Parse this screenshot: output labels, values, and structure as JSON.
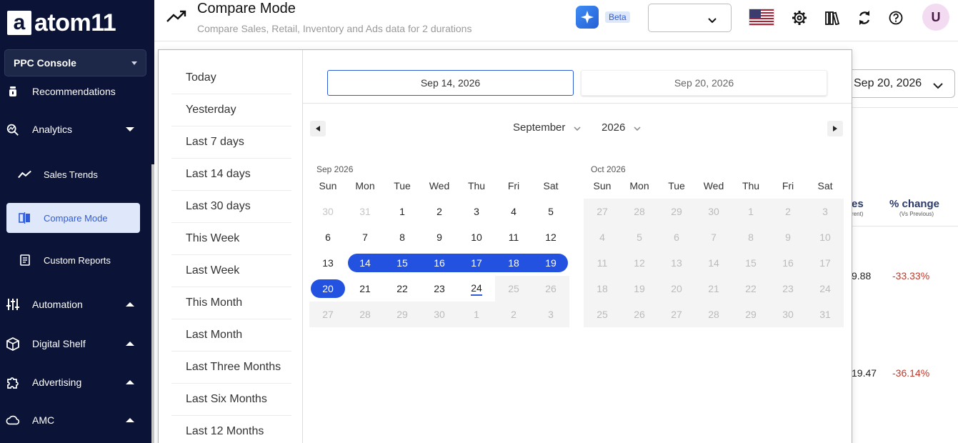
{
  "brand": {
    "logo_letter": "a",
    "name": "atom11"
  },
  "console_select": {
    "value": "PPC Console"
  },
  "sidebar": {
    "items": [
      {
        "label": "Recommendations",
        "icon": "bulb-icon"
      },
      {
        "label": "Analytics",
        "icon": "analytics-icon"
      },
      {
        "label": "Automation",
        "icon": "sliders-icon"
      },
      {
        "label": "Digital Shelf",
        "icon": "box-icon"
      },
      {
        "label": "Advertising",
        "icon": "puzzle-icon"
      },
      {
        "label": "AMC",
        "icon": "cloud-icon"
      }
    ],
    "subitems": [
      {
        "label": "Sales Trends",
        "icon": "trend-icon"
      },
      {
        "label": "Compare Mode",
        "icon": "compare-icon",
        "active": true
      },
      {
        "label": "Custom Reports",
        "icon": "report-icon"
      }
    ]
  },
  "header": {
    "title": "Compare Mode",
    "subtitle": "Compare Sales, Retail, Inventory and Ads data for 2 durations",
    "beta": "Beta",
    "select_value": "",
    "avatar": "U"
  },
  "background": {
    "date_value": "Sep 20, 2026",
    "col1_title": "es",
    "col1_sub": "rent)",
    "col2_title": "% change",
    "col2_sub": "(Vs Previous)",
    "row1_value": "9.88",
    "row1_change": "-33.33%",
    "row2_value": "19.47",
    "row2_change": "-36.14%",
    "negative_color": "#c0392b"
  },
  "picker": {
    "presets": [
      "Today",
      "Yesterday",
      "Last 7 days",
      "Last 14 days",
      "Last 30 days",
      "This Week",
      "Last Week",
      "This Month",
      "Last Month",
      "Last Three Months",
      "Last Six Months",
      "Last 12 Months"
    ],
    "start_date": "Sep 14, 2026",
    "end_date": "Sep 20, 2026",
    "month_select": "September",
    "year_select": "2026",
    "weekdays": [
      "Sun",
      "Mon",
      "Tue",
      "Wed",
      "Thu",
      "Fri",
      "Sat"
    ],
    "accent": "#2452e0",
    "calendars": [
      {
        "label": "Sep 2026",
        "weeks": [
          [
            30,
            31,
            1,
            2,
            3,
            4,
            5
          ],
          [
            6,
            7,
            8,
            9,
            10,
            11,
            12
          ],
          [
            13,
            14,
            15,
            16,
            17,
            18,
            19
          ],
          [
            20,
            21,
            22,
            23,
            24,
            25,
            26
          ],
          [
            27,
            28,
            29,
            30,
            1,
            2,
            3
          ]
        ],
        "outside": [
          [
            0,
            0
          ],
          [
            0,
            1
          ]
        ],
        "passive_from": [
          3,
          5
        ],
        "today": [
          3,
          4
        ],
        "selected": [
          [
            2,
            1
          ],
          [
            2,
            2
          ],
          [
            2,
            3
          ],
          [
            2,
            4
          ],
          [
            2,
            5
          ],
          [
            2,
            6
          ],
          [
            3,
            0
          ]
        ]
      },
      {
        "label": "Oct 2026",
        "weeks": [
          [
            27,
            28,
            29,
            30,
            1,
            2,
            3
          ],
          [
            4,
            5,
            6,
            7,
            8,
            9,
            10
          ],
          [
            11,
            12,
            13,
            14,
            15,
            16,
            17
          ],
          [
            18,
            19,
            20,
            21,
            22,
            23,
            24
          ],
          [
            25,
            26,
            27,
            28,
            29,
            30,
            31
          ]
        ],
        "all_passive": true
      }
    ]
  }
}
